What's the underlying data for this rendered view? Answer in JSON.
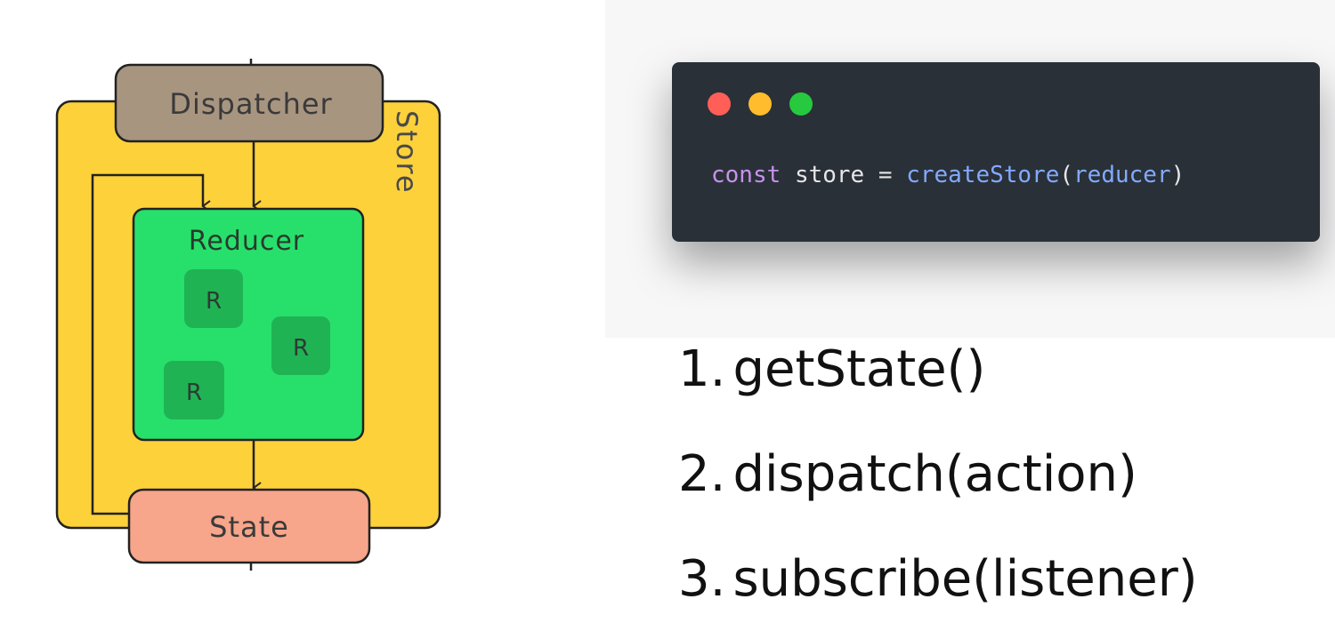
{
  "diagram": {
    "dispatcher_label": "Dispatcher",
    "store_label": "Store",
    "reducer_label": "Reducer",
    "sub_reducer_label": "R",
    "state_label": "State"
  },
  "code": {
    "keyword": "const",
    "variable": "store",
    "operator": "=",
    "function": "createStore",
    "open_paren": "(",
    "argument": "reducer",
    "close_paren": ")"
  },
  "api_methods": [
    {
      "number": "1.",
      "name": "getState()"
    },
    {
      "number": "2.",
      "name": "dispatch(action)"
    },
    {
      "number": "3.",
      "name": "subscribe(listener)"
    }
  ],
  "colors": {
    "store": "#fdd13a",
    "dispatcher": "#a89580",
    "reducer": "#27e06b",
    "sub_reducer": "#1fb354",
    "state": "#f7a58b",
    "code_bg": "#2a3038"
  }
}
